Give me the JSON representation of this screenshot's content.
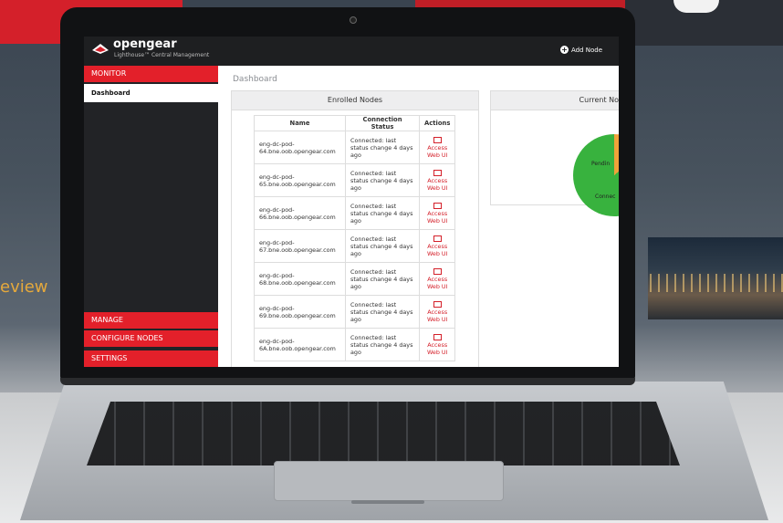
{
  "background": {
    "partial_text": "eview"
  },
  "app": {
    "brand": "opengear",
    "tagline": "Lighthouse™ Central Management",
    "add_node": "Add Node"
  },
  "sidebar": {
    "monitor": "MONITOR",
    "dashboard": "Dashboard",
    "manage": "MANAGE",
    "configure_nodes": "CONFIGURE NODES",
    "settings": "SETTINGS"
  },
  "main": {
    "page_title": "Dashboard",
    "enrolled_nodes": {
      "title": "Enrolled Nodes",
      "columns": [
        "Name",
        "Connection Status",
        "Actions"
      ],
      "rows": [
        {
          "name": "eng-dc-pod-64.bne.oob.opengear.com",
          "status": "Connected: last status change 4 days ago",
          "action": "Access Web UI"
        },
        {
          "name": "eng-dc-pod-65.bne.oob.opengear.com",
          "status": "Connected: last status change 4 days ago",
          "action": "Access Web UI"
        },
        {
          "name": "eng-dc-pod-66.bne.oob.opengear.com",
          "status": "Connected: last status change 4 days ago",
          "action": "Access Web UI"
        },
        {
          "name": "eng-dc-pod-67.bne.oob.opengear.com",
          "status": "Connected: last status change 4 days ago",
          "action": "Access Web UI"
        },
        {
          "name": "eng-dc-pod-68.bne.oob.opengear.com",
          "status": "Connected: last status change 4 days ago",
          "action": "Access Web UI"
        },
        {
          "name": "eng-dc-pod-69.bne.oob.opengear.com",
          "status": "Connected: last status change 4 days ago",
          "action": "Access Web UI"
        },
        {
          "name": "eng-dc-pod-6A.bne.oob.opengear.com",
          "status": "Connected: last status change 4 days ago",
          "action": "Access Web UI"
        }
      ]
    },
    "current_nodes": {
      "title": "Current No",
      "labels": {
        "pending": "Pendin",
        "connected": "Connec"
      },
      "colors": {
        "pending": "#f0a23a",
        "connected": "#38b23e"
      }
    }
  },
  "colors": {
    "accent": "#e3202a",
    "sidebar": "#222326",
    "topbar": "#1e1f21"
  }
}
